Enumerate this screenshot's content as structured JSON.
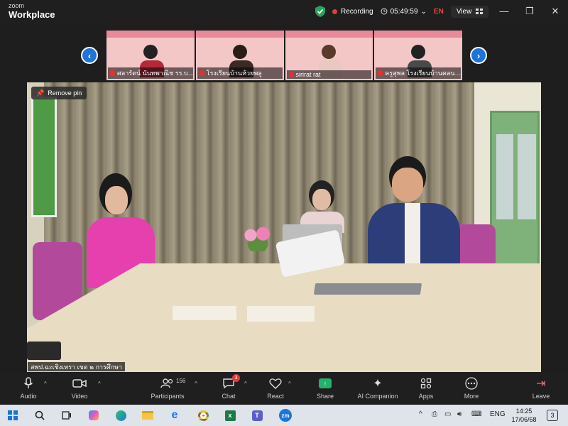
{
  "app": {
    "brand_small": "zoom",
    "brand_large": "Workplace"
  },
  "titlebar": {
    "recording_label": "Recording",
    "timer": "05:49:59",
    "language": "EN",
    "view_label": "View"
  },
  "thumbnails": [
    {
      "name": "ศลารัตน์ นันทพาณิช รร.บ…"
    },
    {
      "name": "โรงเรียนบ้านห้วยพลู"
    },
    {
      "name": "sirirat rat"
    },
    {
      "name": "ครูสุพล โรงเรียนบ้านคลน…"
    }
  ],
  "video": {
    "remove_pin_label": "Remove pin",
    "speaker_label": "สพป.ฉะเชิงเทรา เขต ๒ การศึกษา"
  },
  "toolbar": {
    "audio": "Audio",
    "video": "Video",
    "participants": "Participants",
    "participants_count": "156",
    "chat": "Chat",
    "chat_badge": "3",
    "react": "React",
    "share": "Share",
    "ai_companion": "AI Companion",
    "apps": "Apps",
    "more": "More",
    "leave": "Leave"
  },
  "taskbar": {
    "lang": "ENG",
    "time": "14:25",
    "date": "17/06/68",
    "notifications": "3"
  },
  "colors": {
    "accent": "#1e74d8",
    "recording": "#e0413c",
    "share": "#1fb36b"
  }
}
